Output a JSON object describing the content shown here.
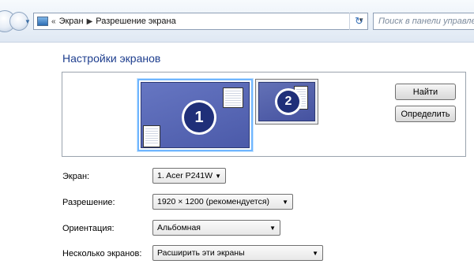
{
  "nav": {
    "breadcrumb_prefix": "«",
    "breadcrumbs": [
      "Экран",
      "Разрешение экрана"
    ],
    "search_placeholder": "Поиск в панели управления"
  },
  "main": {
    "title": "Настройки экранов",
    "monitors": [
      {
        "number": "1",
        "selected": true
      },
      {
        "number": "2",
        "selected": false
      }
    ],
    "buttons": {
      "find": "Найти",
      "identify": "Определить"
    },
    "fields": {
      "display": {
        "label": "Экран:",
        "value": "1. Acer P241W"
      },
      "resolution": {
        "label": "Разрешение:",
        "value": "1920 × 1200 (рекомендуется)"
      },
      "orientation": {
        "label": "Ориентация:",
        "value": "Альбомная"
      },
      "multiple": {
        "label": "Несколько экранов:",
        "value": "Расширить эти экраны"
      }
    }
  },
  "colors": {
    "title": "#1e3e8e",
    "selection": "#6fb6ff",
    "monitor_fill": "#4b5aa9"
  },
  "icons": {
    "address": "control-panel-icon",
    "refresh": "refresh-icon"
  }
}
